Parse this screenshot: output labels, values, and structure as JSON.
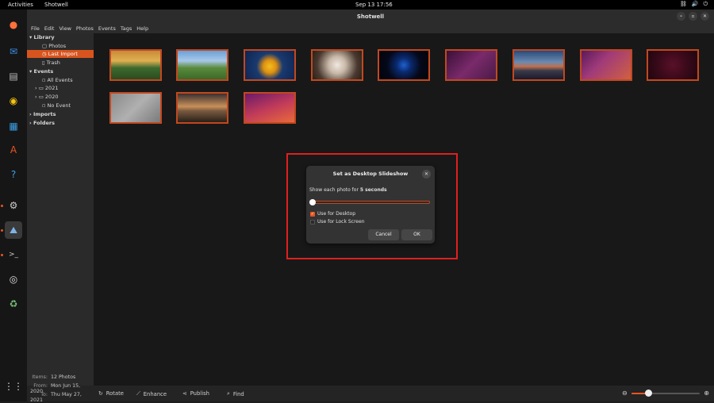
{
  "topbar": {
    "activities": "Activities",
    "app_name": "Shotwell",
    "clock": "Sep 13  17:56"
  },
  "window": {
    "title": "Shotwell"
  },
  "menu": [
    "File",
    "Edit",
    "View",
    "Photos",
    "Events",
    "Tags",
    "Help"
  ],
  "sidebar": {
    "library": "Library",
    "photos": "Photos",
    "last_import": "Last Import",
    "trash": "Trash",
    "events": "Events",
    "all_events": "All Events",
    "year_2021": "2021",
    "year_2020": "2020",
    "no_event": "No Event",
    "imports": "Imports",
    "folders": "Folders",
    "meta": {
      "items_label": "Items:",
      "items_value": "12 Photos",
      "from_label": "From:",
      "from_value": "Mon Jun 15, 2020",
      "to_label": "To:",
      "to_value": "Thu May 27, 2021"
    }
  },
  "bottombar": {
    "rotate": "Rotate",
    "enhance": "Enhance",
    "publish": "Publish",
    "find": "Find",
    "zoom_level": 0.25
  },
  "dialog": {
    "title": "Set as Desktop Slideshow",
    "label_prefix": "Show each photo for",
    "label_value": "5 seconds",
    "slider_value": 0,
    "use_desktop": "Use for Desktop",
    "use_desktop_checked": true,
    "use_lock": "Use for Lock Screen",
    "use_lock_checked": false,
    "cancel": "Cancel",
    "ok": "OK"
  },
  "colors": {
    "accent": "#e95420",
    "selection": "#d8541f",
    "highlight_box": "#e0201e"
  },
  "icons": [
    "firefox-icon",
    "thunderbird-icon",
    "files-icon",
    "rhythmbox-icon",
    "writer-icon",
    "software-icon",
    "help-icon",
    "settings-icon",
    "shotwell-icon",
    "terminal-icon",
    "disc-icon",
    "trash-icon",
    "app-grid-icon"
  ]
}
